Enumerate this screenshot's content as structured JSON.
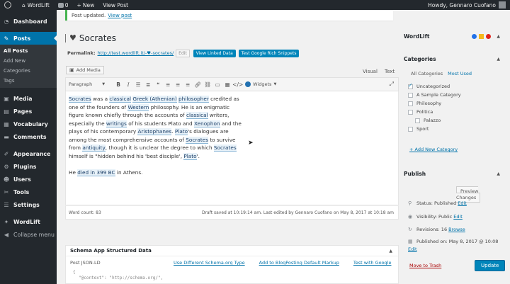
{
  "adminbar": {
    "site": "WordLift",
    "comments": "0",
    "new": "New",
    "view_post": "View Post",
    "howdy": "Howdy, Gennaro Cuofano"
  },
  "sidebar": {
    "items": [
      {
        "label": "Dashboard",
        "icon": "dashboard-icon",
        "glyph": "◔"
      },
      {
        "label": "Posts",
        "icon": "pin-icon",
        "glyph": "✎"
      },
      {
        "label": "Media",
        "icon": "media-icon",
        "glyph": "▣"
      },
      {
        "label": "Pages",
        "icon": "pages-icon",
        "glyph": "▤"
      },
      {
        "label": "Vocabulary",
        "icon": "vocabulary-icon",
        "glyph": "▦"
      },
      {
        "label": "Comments",
        "icon": "comments-icon",
        "glyph": "▬"
      },
      {
        "label": "Appearance",
        "icon": "appearance-icon",
        "glyph": "✐"
      },
      {
        "label": "Plugins",
        "icon": "plugins-icon",
        "glyph": "⚙"
      },
      {
        "label": "Users",
        "icon": "users-icon",
        "glyph": "☻"
      },
      {
        "label": "Tools",
        "icon": "tools-icon",
        "glyph": "✂"
      },
      {
        "label": "Settings",
        "icon": "settings-icon",
        "glyph": "☰"
      },
      {
        "label": "WordLift",
        "icon": "wordlift-icon",
        "glyph": "✦"
      },
      {
        "label": "Collapse menu",
        "icon": "collapse-icon",
        "glyph": "◀"
      }
    ],
    "submenu": [
      "All Posts",
      "Add New",
      "Categories",
      "Tags"
    ]
  },
  "notice": {
    "text": "Post updated.",
    "link": "View post"
  },
  "post": {
    "title": "Socrates",
    "permalink_label": "Permalink:",
    "permalink_url": "http://test.wordlift.it/-♥-socrates/",
    "edit": "Edit",
    "btn_linked": "View Linked Data",
    "btn_snippets": "Test Google Rich Snippets"
  },
  "editor": {
    "add_media": "Add Media",
    "tab_visual": "Visual",
    "tab_text": "Text",
    "format": "Paragraph",
    "widgets": "Widgets",
    "word_count": "Word count: 83",
    "draft_saved": "Draft saved at 10:19:14 am. Last edited by Gennaro Cuofano on May 8, 2017 at 10:18 am"
  },
  "content": {
    "p1": [
      {
        "t": "Socrates",
        "e": true
      },
      {
        "t": " was a "
      },
      {
        "t": "classical",
        "e": true
      },
      {
        "t": " "
      },
      {
        "t": "Greek (Athenian)",
        "e": true
      },
      {
        "t": " "
      },
      {
        "t": "philosopher",
        "e": true
      },
      {
        "t": " credited as one of the founders of "
      },
      {
        "t": "Western",
        "e": true
      },
      {
        "t": " philosophy. He is an enigmatic figure known chiefly through the accounts of "
      },
      {
        "t": "classical",
        "e": true
      },
      {
        "t": " writers, especially the "
      },
      {
        "t": "writings",
        "e": true
      },
      {
        "t": " of his students Plato and "
      },
      {
        "t": "Xenophon",
        "e": true
      },
      {
        "t": " and the plays of his contemporary "
      },
      {
        "t": "Aristophanes",
        "e": true
      },
      {
        "t": ". "
      },
      {
        "t": "Plato",
        "e": true
      },
      {
        "t": "'s dialogues are among the most comprehensive accounts of "
      },
      {
        "t": "Socrates",
        "e": true
      },
      {
        "t": " to survive from "
      },
      {
        "t": "antiquity",
        "e": true
      },
      {
        "t": ", though it is unclear the degree to which "
      },
      {
        "t": "Socrates",
        "e": true
      },
      {
        "t": " himself is \"hidden behind his 'best disciple', "
      },
      {
        "t": "Plato",
        "e": true
      },
      {
        "t": "'."
      }
    ],
    "p2": [
      {
        "t": "He "
      },
      {
        "t": "died in 399 BC",
        "e": true
      },
      {
        "t": " in Athens."
      }
    ]
  },
  "schema": {
    "title": "Schema App Structured Data",
    "label": "Post JSON-LD",
    "link1": "Use Different Schema.org Type",
    "link2": "Add to BlogPosting Default Markup",
    "link3": "Test with Google",
    "code1": "{",
    "code2": "\"@context\": \"http://schema.org/\","
  },
  "wordlift_box": {
    "title": "WordLift",
    "colors": [
      "#2271e8",
      "#f6b81c",
      "#e0231b"
    ]
  },
  "categories": {
    "title": "Categories",
    "tab_all": "All Categories",
    "tab_most": "Most Used",
    "items": [
      {
        "label": "Uncategorized",
        "checked": true,
        "child": false
      },
      {
        "label": "A Sample Category",
        "checked": false,
        "child": false
      },
      {
        "label": "Philosophy",
        "checked": false,
        "child": false
      },
      {
        "label": "Politica",
        "checked": false,
        "child": false
      },
      {
        "label": "Palazzo",
        "checked": false,
        "child": true
      },
      {
        "label": "Sport",
        "checked": false,
        "child": false
      }
    ],
    "add_new": "+ Add New Category"
  },
  "publish": {
    "title": "Publish",
    "preview": "Preview Changes",
    "status_label": "Status: Published",
    "visibility_label": "Visibility: Public",
    "revisions_label": "Revisions: 16",
    "revisions_link": "Browse",
    "published_label": "Published on: May 8, 2017 @ 10:08",
    "edit": "Edit",
    "trash": "Move to Trash",
    "update": "Update"
  }
}
